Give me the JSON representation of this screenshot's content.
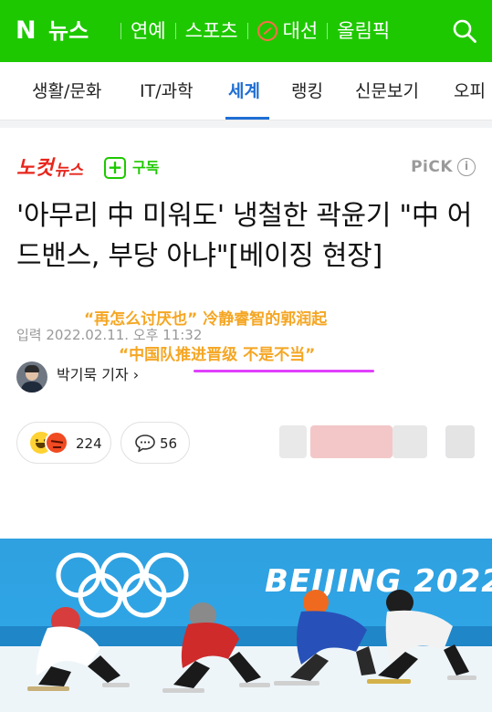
{
  "header": {
    "logo": "N",
    "logo_text": "뉴스",
    "nav": [
      "연예",
      "스포츠",
      "대선",
      "올림픽"
    ]
  },
  "subnav": {
    "tabs": [
      "생활/문화",
      "IT/과학",
      "세계",
      "랭킹",
      "신문보기",
      "오피"
    ],
    "active": "세계"
  },
  "article": {
    "press_part1": "노컷",
    "press_part2": "뉴스",
    "subscribe_label": "구독",
    "pick_label": "PiCK",
    "pick_info": "i",
    "headline": "'아무리 中 미워도' 냉철한 곽윤기 \"中 어드밴스, 부당 아냐\"[베이징 현장]",
    "date": "입력 2022.02.11. 오후 11:32",
    "reporter": "박기묵 기자 ›",
    "reactions_count": "224",
    "comments_count": "56"
  },
  "overlay": {
    "caption1": "“再怎么讨厌也” 冷静睿智的郭润起",
    "caption2": "“中国队推进晋级 不是不当”"
  },
  "photo": {
    "banner_text": "BEIJING 2022"
  },
  "colors": {
    "brand_green": "#1ec800",
    "active_tab_blue": "#1f6ed4",
    "press_red": "#e8261c",
    "caption_orange": "#f5a623",
    "caption_underline": "#e040fb"
  }
}
